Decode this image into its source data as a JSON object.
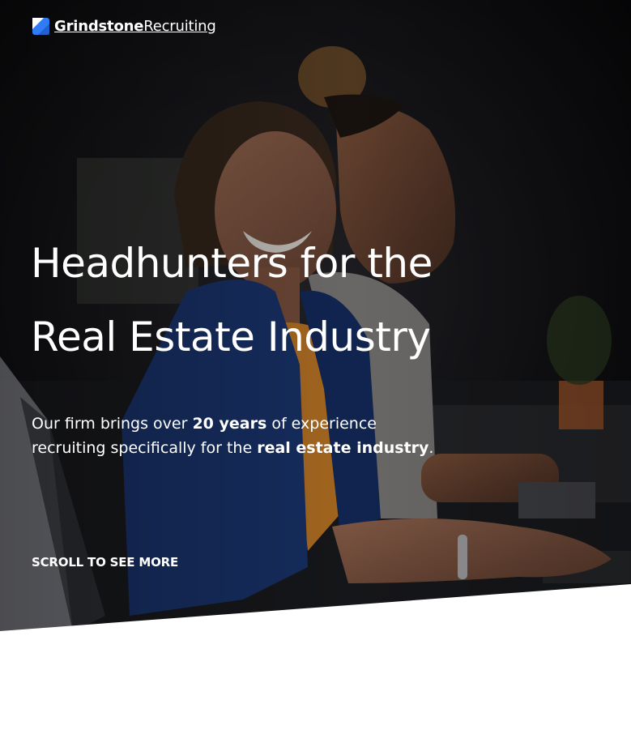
{
  "brand": {
    "name_bold": "Grindstone",
    "name_light": "Recruiting",
    "accent": "#2f7cf6",
    "icon": "grindstone-logo-mark-icon"
  },
  "hero": {
    "headline_line1": "Headhunters for the",
    "headline_line2": "Real Estate Industry",
    "intro": {
      "part1": "Our firm brings over ",
      "bold1": "20 years",
      "part2": " of experience",
      "part3": "recruiting specifically for the ",
      "bold2": "real estate industry",
      "part4": "."
    },
    "scroll_label": "SCROLL TO SEE MORE",
    "background_image": "smiling-woman-office-photo"
  },
  "colors": {
    "text": "#ffffff",
    "hero_bg": "#0b0b0d",
    "page_bg": "#ffffff"
  }
}
